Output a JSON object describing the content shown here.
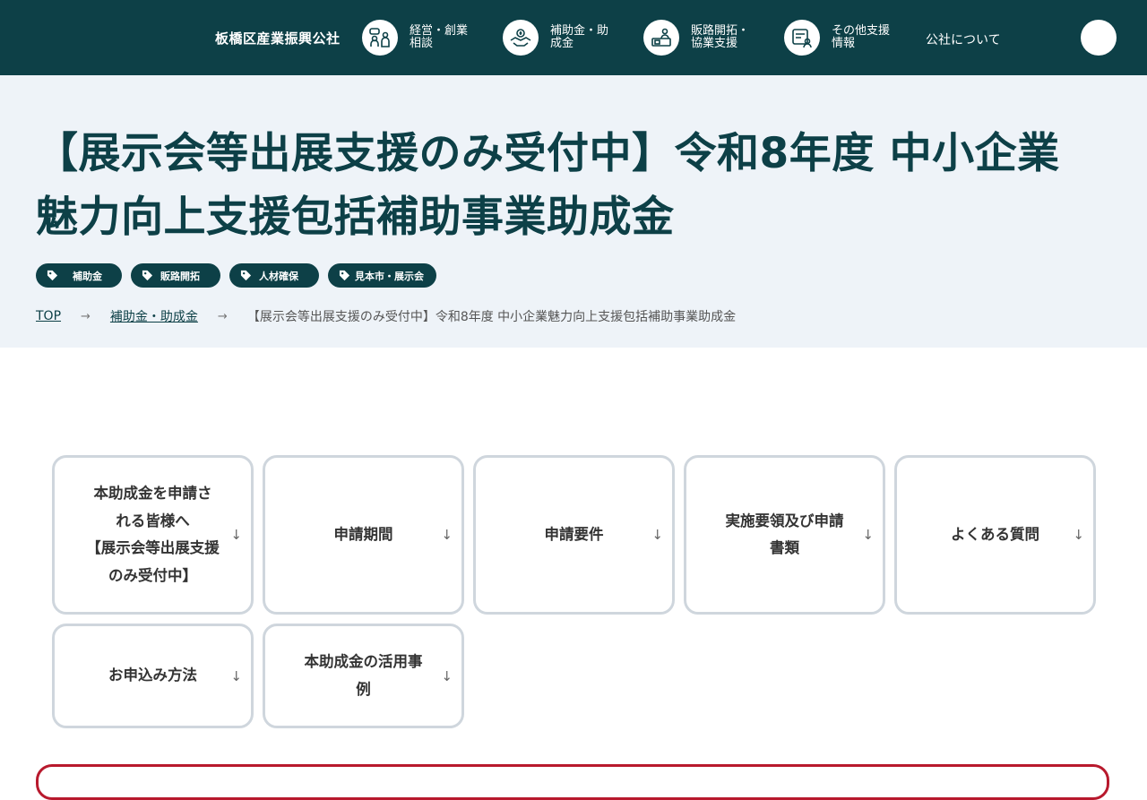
{
  "header": {
    "logo": "板橋区産業振興公社",
    "nav": [
      {
        "line1": "経営・創業",
        "line2": "相談",
        "icon": "consultation-icon"
      },
      {
        "line1": "補助金・助",
        "line2": "成金",
        "icon": "subsidy-handshake-icon"
      },
      {
        "line1": "販路開拓・",
        "line2": "協業支援",
        "icon": "sales-booth-icon"
      },
      {
        "line1": "その他支援",
        "line2": "情報",
        "icon": "document-person-icon"
      }
    ],
    "about": "公社について"
  },
  "hero": {
    "title_line1": "【展示会等出展支援のみ受付中】令和8年度 中小企業",
    "title_line2": "魅力向上支援包括補助事業助成金",
    "tags": [
      "補助金",
      "販路開拓",
      "人材確保",
      "見本市・展示会"
    ],
    "breadcrumb": {
      "items": [
        "TOP",
        "補助金・助成金"
      ],
      "current": "【展示会等出展支援のみ受付中】令和8年度 中小企業魅力向上支援包括補助事業助成金",
      "separator": "→"
    }
  },
  "anchors": [
    {
      "lines": [
        "本助成金を申請さ",
        "れる皆様へ",
        "【展示会等出展支援",
        "のみ受付中】"
      ]
    },
    {
      "lines": [
        "申請期間"
      ]
    },
    {
      "lines": [
        "申請要件"
      ]
    },
    {
      "lines": [
        "実施要領及び申請",
        "書類"
      ]
    },
    {
      "lines": [
        "よくある質問"
      ]
    },
    {
      "lines": [
        "お申込み方法"
      ]
    },
    {
      "lines": [
        "本助成金の活用事",
        "例"
      ]
    }
  ],
  "anchor_arrow": "↓",
  "colors": {
    "brand": "#0d4047",
    "hero_bg": "#eef3f8",
    "alert_border": "#b8192d"
  }
}
